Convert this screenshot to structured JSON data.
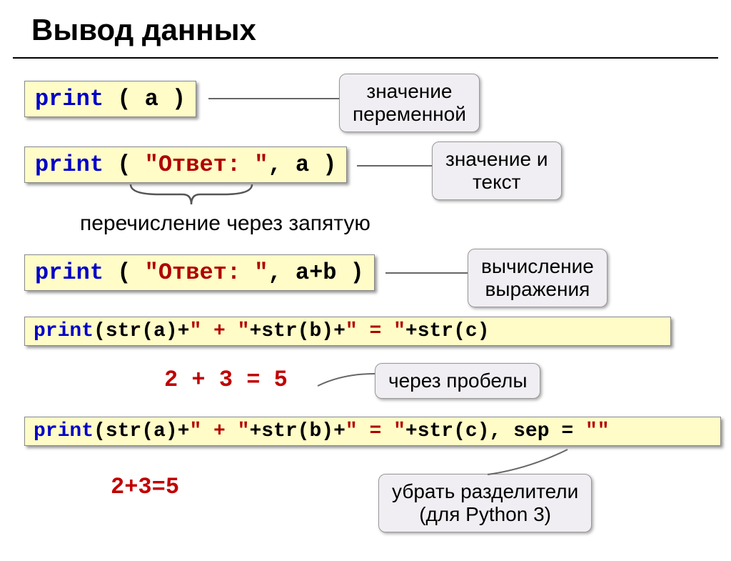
{
  "title": "Вывод данных",
  "blocks": {
    "print1": {
      "kw": "print",
      "rest": " ( a )"
    },
    "print2": {
      "kw": "print",
      "rest1": " ( ",
      "str": "\"Ответ: \"",
      "rest2": ", a )"
    },
    "print3": {
      "kw": "print",
      "rest1": " ( ",
      "str": "\"Ответ: \"",
      "rest2": ", a+b )"
    },
    "print4": {
      "kw": "print",
      "rest1": "(str(a)+",
      "s1": "\" + \"",
      "rest2": "+str(b)+",
      "s2": "\" = \"",
      "rest3": "+str(c)"
    },
    "print5": {
      "kw": "print",
      "rest1": "(str(a)+",
      "s1": "\" + \"",
      "rest2": "+str(b)+",
      "s2": "\" = \"",
      "rest3": "+str(c), sep = ",
      "s3": "\"\""
    }
  },
  "callouts": {
    "c1": "значение\nпеременной",
    "c2": "значение и\nтекст",
    "c3": "вычисление\nвыражения",
    "c4": "через пробелы",
    "c5": "убрать разделители\n(для Python 3)"
  },
  "labels": {
    "enum": "перечисление через запятую"
  },
  "expressions": {
    "e1": "2 + 3 = 5",
    "e2": "2+3=5"
  }
}
